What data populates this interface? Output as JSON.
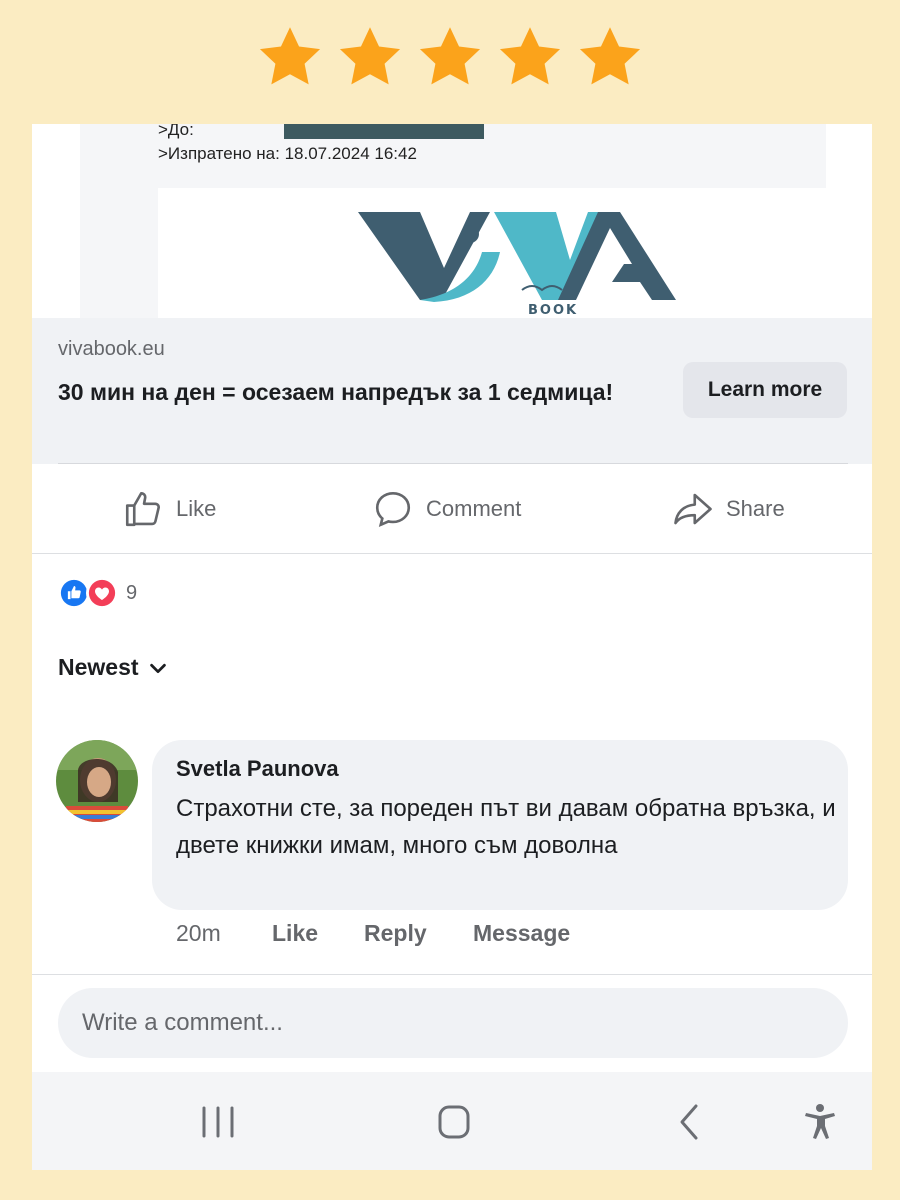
{
  "rating": {
    "stars": 5,
    "color": "#fba31b"
  },
  "email": {
    "to_label": ">До:",
    "sent_label": ">Изпратено на: 18.07.2024 16:42",
    "logo_alt": "VIVA BOOK"
  },
  "link_preview": {
    "domain": "vivabook.eu",
    "headline": "30 мин на ден = осезаем напредък за 1 седмица!",
    "cta_label": "Learn more"
  },
  "actions": {
    "like_label": "Like",
    "comment_label": "Comment",
    "share_label": "Share"
  },
  "reactions": {
    "icons": [
      "like-reaction",
      "love-reaction"
    ],
    "count": "9"
  },
  "sort": {
    "label": "Newest"
  },
  "comment": {
    "author": "Svetla Paunova",
    "text": "Страхотни сте, за пореден път ви давам обратна връзка, и двете книжки имам, много съм доволна",
    "time": "20m",
    "like_label": "Like",
    "reply_label": "Reply",
    "message_label": "Message"
  },
  "composer": {
    "placeholder": "Write a comment..."
  },
  "colors": {
    "background": "#fbecc2",
    "logo_dark": "#3f5e70",
    "logo_teal": "#4fb8c8"
  }
}
